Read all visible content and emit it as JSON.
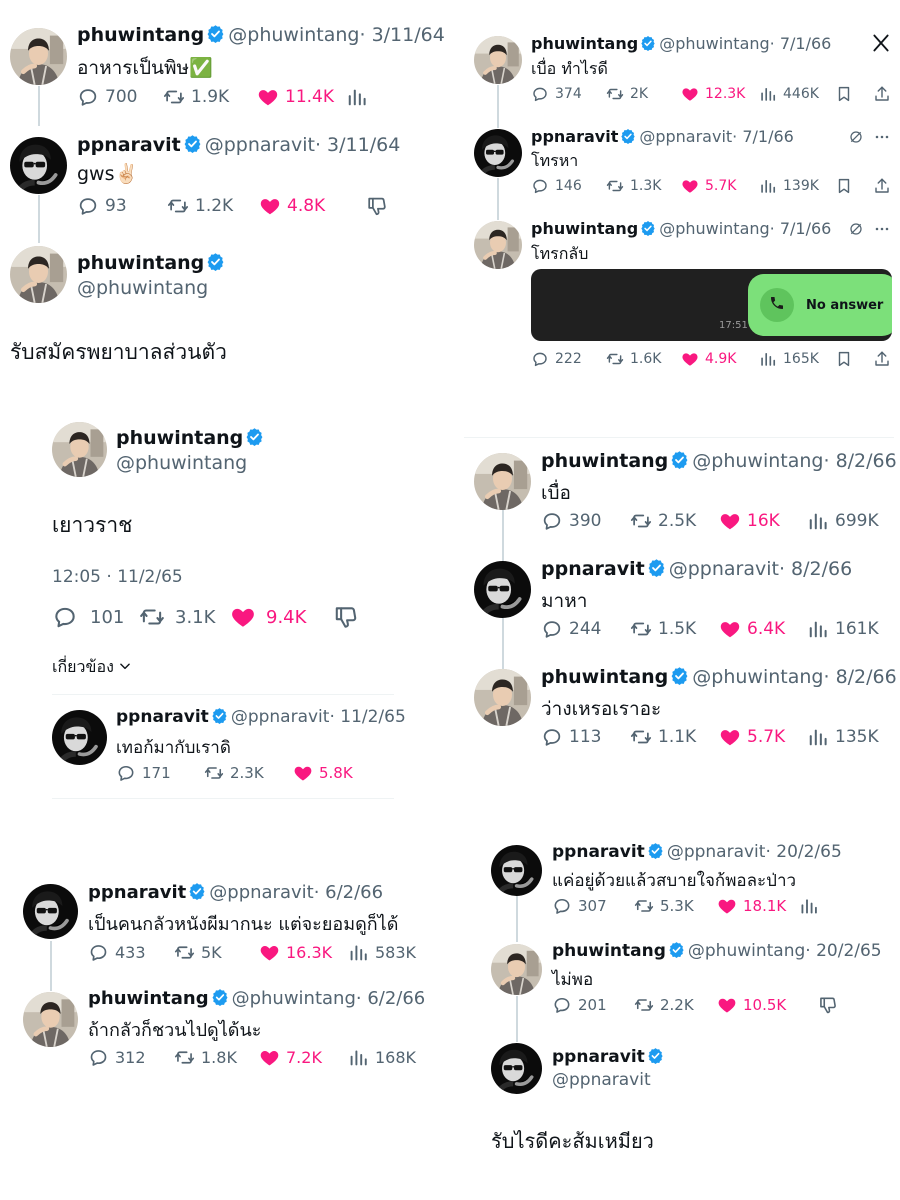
{
  "colors": {
    "like": "#f91880",
    "gray": "#536471",
    "verified": "#1d9bf0",
    "thread_line": "#cfd9de",
    "call_green": "#7ce07a",
    "call_dark": "#202020"
  },
  "icons": [
    "reply-icon",
    "retweet-icon",
    "heart-icon",
    "views-icon",
    "bookmark-icon",
    "share-icon",
    "dislike-icon",
    "verified-icon",
    "x-logo-icon",
    "hide-icon",
    "more-icon",
    "phone-icon",
    "chevron-down-icon"
  ],
  "panel1": {
    "t1": {
      "name": "phuwintang",
      "handle": "@phuwintang",
      "date": "· 3/11/64",
      "text": "อาหารเป็นพิษ✅",
      "reply": "700",
      "rt": "1.9K",
      "like": "11.4K"
    },
    "t2": {
      "name": "ppnaravit",
      "handle": "@ppnaravit",
      "date": "· 3/11/64",
      "text": "gws✌🏻",
      "reply": "93",
      "rt": "1.2K",
      "like": "4.8K"
    },
    "t3": {
      "name": "phuwintang",
      "handle": "@phuwintang",
      "text": "รับสมัครพยาบาลส่วนตัว"
    }
  },
  "panel2": {
    "t1": {
      "name": "phuwintang",
      "handle": "@phuwintang",
      "date": "· 7/1/66",
      "text": "เบื่อ ทำไรดี",
      "reply": "374",
      "rt": "2K",
      "like": "12.3K",
      "views": "446K"
    },
    "t2": {
      "name": "ppnaravit",
      "handle": "@ppnaravit",
      "date": "· 7/1/66",
      "text": "โทรหา",
      "reply": "146",
      "rt": "1.3K",
      "like": "5.7K",
      "views": "139K"
    },
    "t3": {
      "name": "phuwintang",
      "handle": "@phuwintang",
      "date": "· 7/1/66",
      "text": "โทรกลับ",
      "call_time": "17:51",
      "call_label": "No answer",
      "reply": "222",
      "rt": "1.6K",
      "like": "4.9K",
      "views": "165K"
    }
  },
  "panel3": {
    "main": {
      "name": "phuwintang",
      "handle": "@phuwintang",
      "text": "เยาวราช",
      "timestamp": "12:05 · 11/2/65",
      "reply": "101",
      "rt": "3.1K",
      "like": "9.4K",
      "related": "เกี่ยวข้อง"
    },
    "reply": {
      "name": "ppnaravit",
      "handle": "@ppnaravit",
      "date": "· 11/2/65",
      "text": "เทอก้มากับเราดิ",
      "reply": "171",
      "rt": "2.3K",
      "like": "5.8K"
    }
  },
  "panel4": {
    "t1": {
      "name": "phuwintang",
      "handle": "@phuwintang",
      "date": "· 8/2/66",
      "text": "เบื่อ",
      "reply": "390",
      "rt": "2.5K",
      "like": "16K",
      "views": "699K"
    },
    "t2": {
      "name": "ppnaravit",
      "handle": "@ppnaravit",
      "date": "· 8/2/66",
      "text": "มาหา",
      "reply": "244",
      "rt": "1.5K",
      "like": "6.4K",
      "views": "161K"
    },
    "t3": {
      "name": "phuwintang",
      "handle": "@phuwintang",
      "date": "· 8/2/66",
      "text": "ว่างเหรอเราอะ",
      "reply": "113",
      "rt": "1.1K",
      "like": "5.7K",
      "views": "135K"
    }
  },
  "panel5": {
    "t1": {
      "name": "ppnaravit",
      "handle": "@ppnaravit",
      "date": "· 6/2/66",
      "text": "เป็นคนกลัวหนังผีมากนะ แต่จะยอมดูก็ได้",
      "reply": "433",
      "rt": "5K",
      "like": "16.3K",
      "views": "583K"
    },
    "t2": {
      "name": "phuwintang",
      "handle": "@phuwintang",
      "date": "· 6/2/66",
      "text": "ถ้ากลัวก็ชวนไปดูได้นะ",
      "reply": "312",
      "rt": "1.8K",
      "like": "7.2K",
      "views": "168K"
    }
  },
  "panel6": {
    "t1": {
      "name": "ppnaravit",
      "handle": "@ppnaravit",
      "date": "· 20/2/65",
      "text": "แค่อยู่ด้วยแล้วสบายใจก้พอละป่าว",
      "reply": "307",
      "rt": "5.3K",
      "like": "18.1K"
    },
    "t2": {
      "name": "phuwintang",
      "handle": "@phuwintang",
      "date": "· 20/2/65",
      "text": "ไม่พอ",
      "reply": "201",
      "rt": "2.2K",
      "like": "10.5K"
    },
    "t3": {
      "name": "ppnaravit",
      "handle": "@ppnaravit",
      "text": "รับไรดีคะส้มเหมียว"
    }
  }
}
